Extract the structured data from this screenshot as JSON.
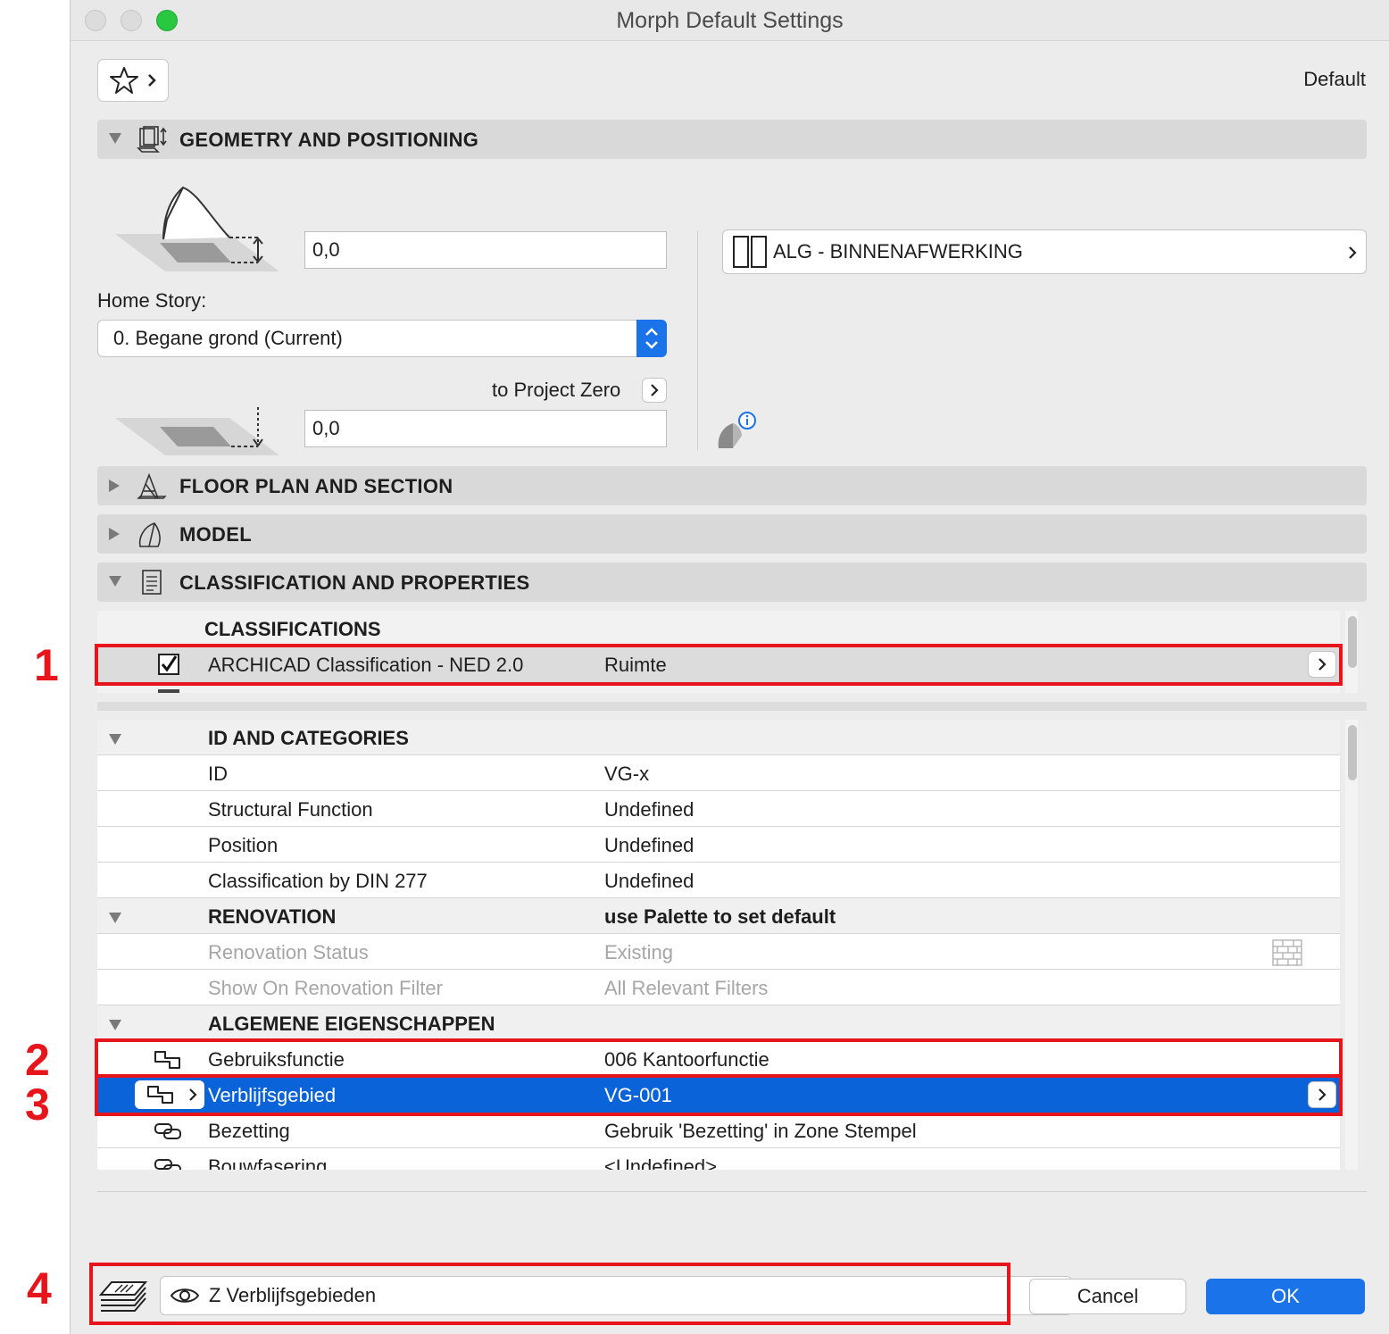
{
  "window": {
    "title": "Morph Default Settings",
    "traffic_colors": [
      "#dcdcdc",
      "#dcdcdc",
      "#2ac840"
    ]
  },
  "header": {
    "default_label": "Default",
    "favorites_icon": "star-icon"
  },
  "sections": {
    "geometry": "GEOMETRY AND POSITIONING",
    "floor_plan": "FLOOR PLAN AND SECTION",
    "model": "MODEL",
    "classification": "CLASSIFICATION AND PROPERTIES"
  },
  "geometry": {
    "height_value": "0,0",
    "home_story_label": "Home Story:",
    "home_story_value": "0. Begane grond (Current)",
    "reference_label": "to Project Zero",
    "offset_value": "0,0",
    "building_material": "ALG - BINNENAFWERKING"
  },
  "classifications": {
    "header": "CLASSIFICATIONS",
    "rows": [
      {
        "system": "ARCHICAD Classification - NED 2.0",
        "value": "Ruimte",
        "checked": true
      }
    ]
  },
  "properties": {
    "rows": [
      {
        "type": "group",
        "label": "ID AND CATEGORIES",
        "value": ""
      },
      {
        "type": "item",
        "label": "ID",
        "value": "VG-x"
      },
      {
        "type": "item",
        "label": "Structural Function",
        "value": "Undefined"
      },
      {
        "type": "item",
        "label": "Position",
        "value": "Undefined"
      },
      {
        "type": "item",
        "label": "Classification by DIN 277",
        "value": "Undefined"
      },
      {
        "type": "group",
        "label": "RENOVATION",
        "value": "use Palette to set default"
      },
      {
        "type": "dim",
        "label": "Renovation Status",
        "value": "Existing"
      },
      {
        "type": "dim",
        "label": "Show On Renovation Filter",
        "value": "All Relevant Filters"
      },
      {
        "type": "group",
        "label": "ALGEMENE EIGENSCHAPPEN",
        "value": ""
      },
      {
        "type": "item",
        "label": "Gebruiksfunctie",
        "value": "006 Kantoorfunctie"
      },
      {
        "type": "selected",
        "label": "Verblijfsgebied",
        "value": "VG-001"
      },
      {
        "type": "item",
        "label": "Bezetting",
        "value": "Gebruik 'Bezetting' in Zone Stempel"
      },
      {
        "type": "item",
        "label": "Bouwfasering",
        "value": "<Undefined>"
      }
    ]
  },
  "footer": {
    "layer_value": "Z Verblijfsgebieden",
    "cancel_label": "Cancel",
    "ok_label": "OK"
  },
  "annotations": [
    "1",
    "2",
    "3",
    "4"
  ],
  "colors": {
    "highlight": "#e8141c",
    "selection": "#0a63d8",
    "ok_button": "#1a73e8"
  }
}
